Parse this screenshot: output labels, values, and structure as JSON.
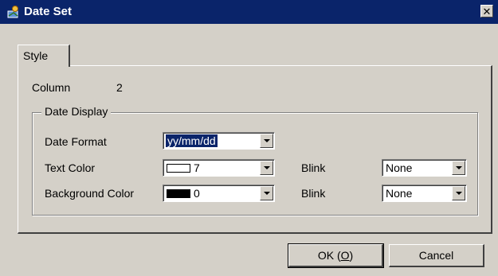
{
  "window": {
    "title": "Date Set",
    "close_glyph": "✕",
    "app_icon": "dialog-app-icon"
  },
  "tabs": [
    {
      "label": "Style",
      "active": true
    }
  ],
  "column": {
    "label": "Column",
    "value": "2"
  },
  "date_display": {
    "group_title": "Date Display",
    "date_format": {
      "label": "Date Format",
      "value": "yy/mm/dd"
    },
    "text_color": {
      "label": "Text Color",
      "value": "7",
      "swatch": "#ffffff",
      "blink_label": "Blink",
      "blink_value": "None"
    },
    "background_color": {
      "label": "Background Color",
      "value": "0",
      "swatch": "#000000",
      "blink_label": "Blink",
      "blink_value": "None"
    }
  },
  "buttons": {
    "ok_prefix": "OK (",
    "ok_mnemonic": "O",
    "ok_suffix": ")",
    "cancel": "Cancel"
  },
  "colors": {
    "titlebar": "#0a246a",
    "dialog_bg": "#d4d0c8",
    "selection": "#0a246a"
  }
}
